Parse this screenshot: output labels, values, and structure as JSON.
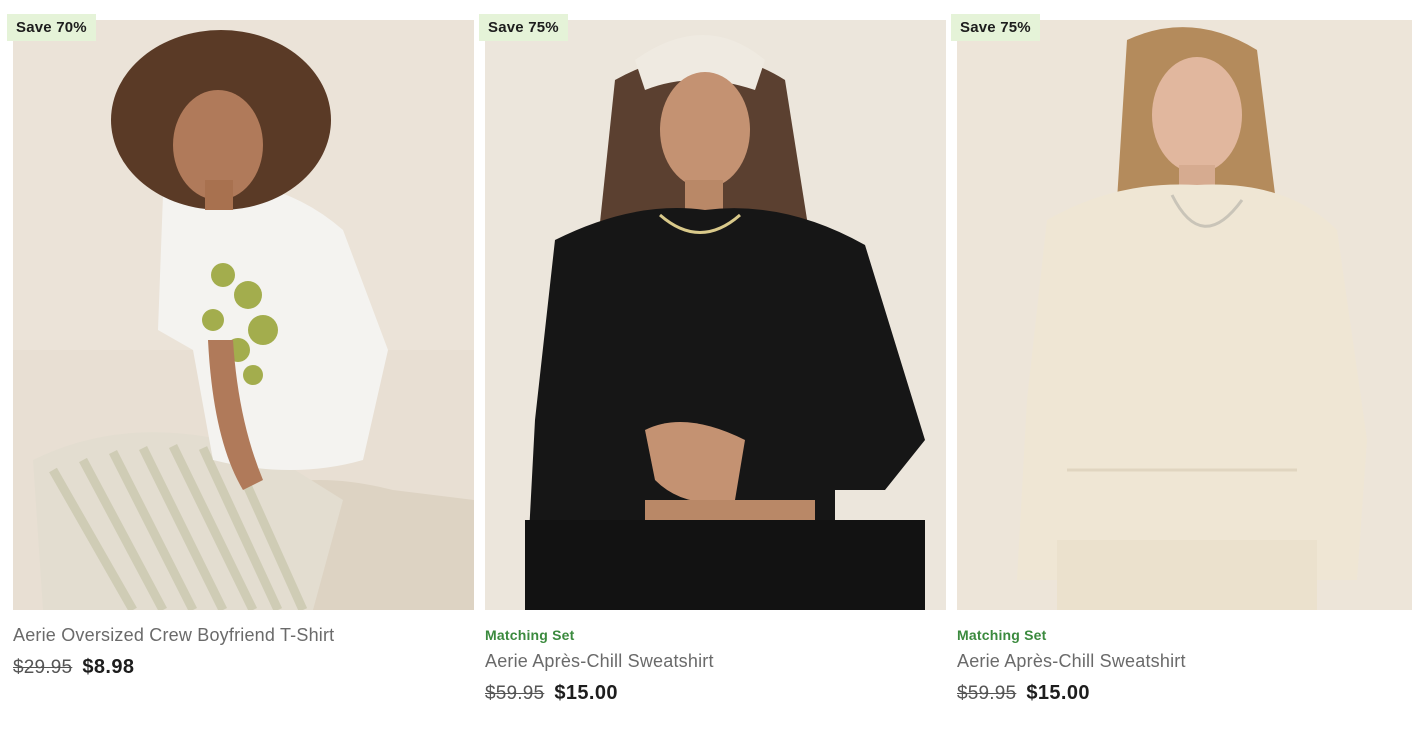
{
  "products": [
    {
      "badge": "Save 70%",
      "tag": "",
      "title": "Aerie Oversized Crew Boyfriend T-Shirt",
      "price_original": "$29.95",
      "price_sale": "$8.98"
    },
    {
      "badge": "Save 75%",
      "tag": "Matching Set",
      "title": "Aerie Après-Chill Sweatshirt",
      "price_original": "$59.95",
      "price_sale": "$15.00"
    },
    {
      "badge": "Save 75%",
      "tag": "Matching Set",
      "title": "Aerie Après-Chill Sweatshirt",
      "price_original": "$59.95",
      "price_sale": "$15.00"
    }
  ],
  "colors": {
    "badge_bg": "#e5f3d8",
    "tag_green": "#3b8a3e",
    "title_gray": "#6a6a6a",
    "price_dark": "#1d1d1d"
  }
}
